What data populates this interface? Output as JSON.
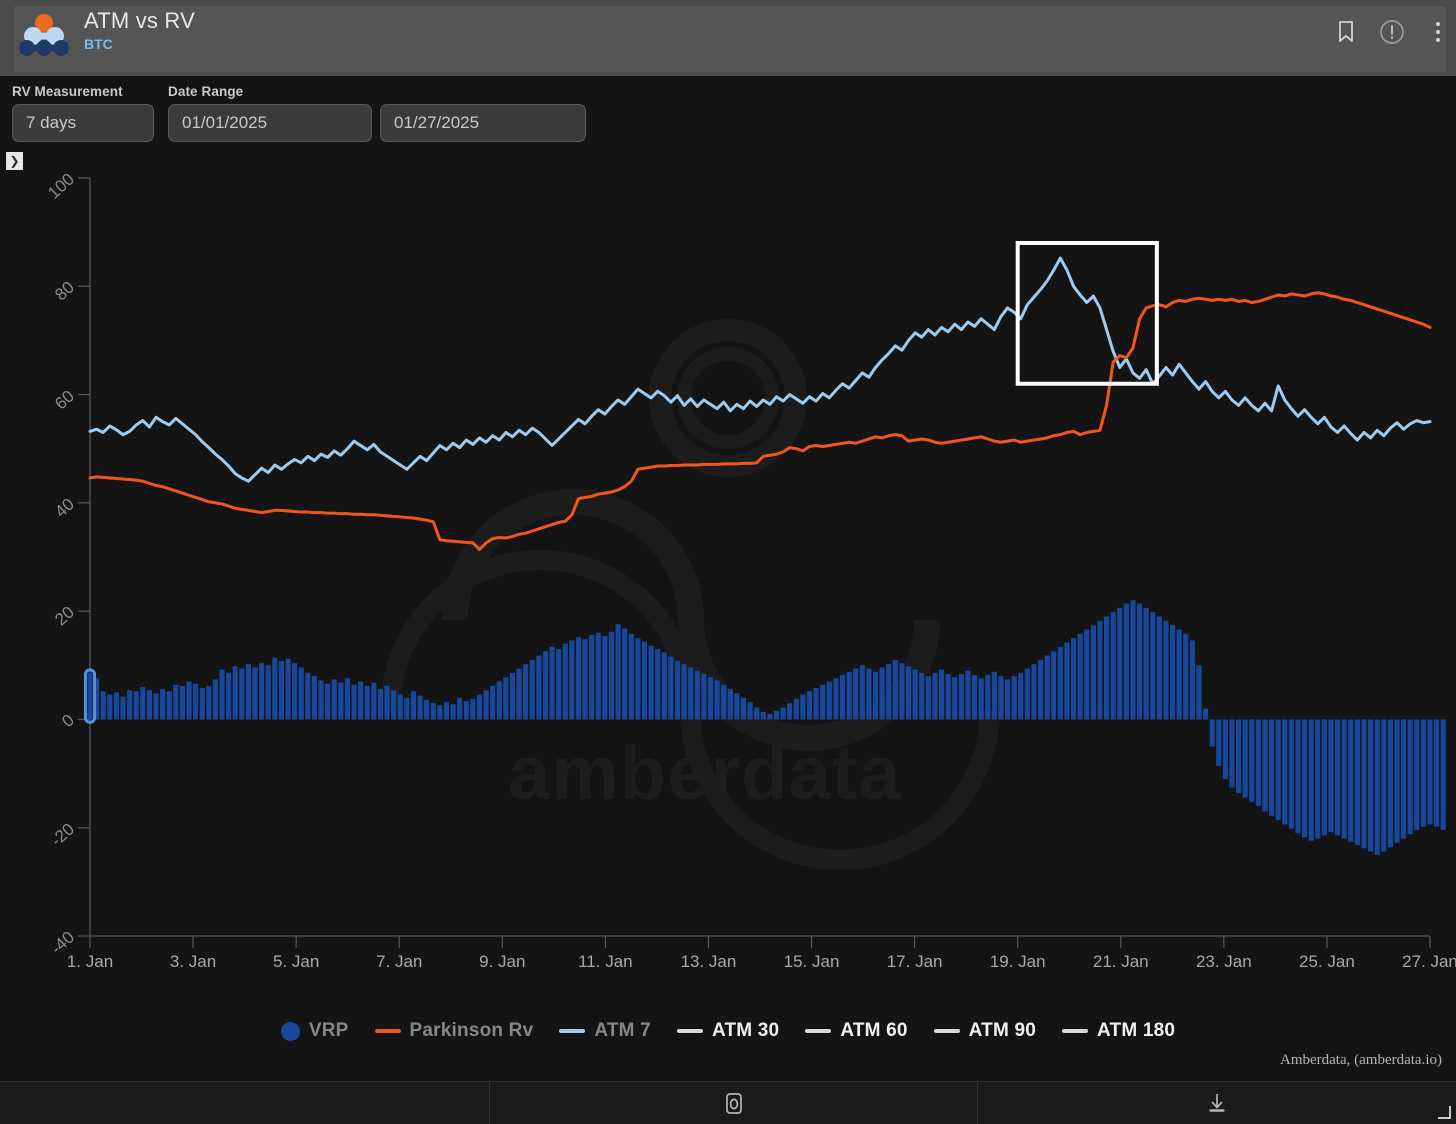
{
  "header": {
    "title": "ATM vs RV",
    "subtitle": "BTC",
    "actions": [
      {
        "name": "bookmark-icon",
        "label": "Bookmark"
      },
      {
        "name": "info-icon",
        "label": "Info"
      },
      {
        "name": "more-menu-icon",
        "label": "More options"
      }
    ],
    "logo_name": "amberdata-logo",
    "logo_colors": {
      "top": "#ee6b1f",
      "middle": "#bcd9ef",
      "bottom": "#1f3a66"
    }
  },
  "controls": {
    "rv_measurement": {
      "label": "RV Measurement",
      "value": "7 days"
    },
    "date_range": {
      "label": "Date Range",
      "start": "01/01/2025",
      "end": "01/27/2025"
    }
  },
  "expander": {
    "glyph": "❯"
  },
  "watermark": {
    "text": "amberdata"
  },
  "attribution": "Amberdata, (amberdata.io)",
  "bottom_bar": {
    "camera_label": "Screenshot",
    "download_label": "Download"
  },
  "chart_data": {
    "type": "line",
    "title": "ATM vs RV",
    "xlabel": "",
    "ylabel": "",
    "ylim": [
      -40,
      100
    ],
    "yticks": [
      100,
      80,
      60,
      40,
      20,
      0,
      -20,
      -40
    ],
    "xlim": [
      "2025-01-01",
      "2025-01-27"
    ],
    "xticks": [
      "1. Jan",
      "3. Jan",
      "5. Jan",
      "7. Jan",
      "9. Jan",
      "11. Jan",
      "13. Jan",
      "15. Jan",
      "17. Jan",
      "19. Jan",
      "21. Jan",
      "23. Jan",
      "25. Jan",
      "27. Jan"
    ],
    "grid": false,
    "legend_position": "bottom",
    "legend": [
      {
        "label": "VRP",
        "color": "#18489e",
        "marker": "dot",
        "visible": true
      },
      {
        "label": "Parkinson Rv",
        "color": "#f2561a",
        "marker": "line",
        "visible": true
      },
      {
        "label": "ATM 7",
        "color": "#9ecbf0",
        "marker": "line",
        "visible": true
      },
      {
        "label": "ATM 30",
        "color": "#d8d8d8",
        "marker": "line",
        "visible": false
      },
      {
        "label": "ATM 60",
        "color": "#d8d8d8",
        "marker": "line",
        "visible": false
      },
      {
        "label": "ATM 90",
        "color": "#d8d8d8",
        "marker": "line",
        "visible": false
      },
      {
        "label": "ATM 180",
        "color": "#d8d8d8",
        "marker": "line",
        "visible": false
      }
    ],
    "annotation": {
      "type": "rectangle",
      "color": "#ffffff",
      "x_start": "2025-01-19",
      "x_end": "2025-01-21.6",
      "y_top": 88,
      "y_bottom": 62
    },
    "highlighted_bar_index": 0,
    "series": [
      {
        "name": "ATM 7",
        "color": "#9ecbf0",
        "values": [
          53.2,
          53.6,
          53.0,
          54.2,
          53.5,
          52.6,
          53.2,
          54.4,
          55.2,
          54.0,
          55.8,
          55.0,
          54.4,
          55.6,
          54.6,
          53.6,
          52.6,
          51.3,
          50.2,
          49.0,
          48.0,
          46.8,
          45.4,
          44.6,
          44.0,
          45.2,
          46.4,
          45.6,
          47.0,
          46.2,
          47.2,
          48.0,
          47.4,
          48.6,
          47.8,
          49.0,
          48.4,
          49.6,
          48.8,
          50.0,
          51.4,
          50.6,
          49.8,
          50.8,
          49.4,
          48.6,
          47.8,
          47.0,
          46.2,
          47.4,
          48.6,
          47.8,
          49.2,
          50.6,
          49.8,
          51.0,
          50.2,
          51.6,
          50.8,
          52.0,
          51.2,
          52.4,
          51.6,
          53.0,
          52.2,
          53.4,
          52.6,
          53.8,
          53.0,
          51.8,
          50.6,
          51.8,
          53.0,
          54.2,
          55.4,
          54.6,
          56.0,
          57.2,
          56.4,
          57.8,
          59.0,
          58.2,
          59.6,
          61.0,
          60.2,
          59.4,
          60.6,
          59.8,
          58.6,
          59.8,
          58.0,
          59.2,
          57.8,
          59.0,
          58.2,
          57.4,
          58.6,
          57.0,
          58.2,
          57.4,
          58.8,
          57.8,
          59.0,
          58.2,
          59.6,
          58.8,
          60.0,
          59.2,
          58.4,
          59.6,
          58.8,
          60.2,
          59.4,
          60.8,
          62.0,
          61.2,
          62.6,
          64.0,
          63.2,
          65.0,
          66.4,
          67.6,
          69.0,
          68.2,
          70.0,
          71.4,
          70.6,
          72.0,
          71.0,
          72.4,
          71.6,
          73.0,
          72.0,
          73.4,
          72.6,
          74.0,
          73.0,
          72.0,
          74.4,
          76.0,
          75.2,
          74.0,
          76.6,
          78.0,
          79.4,
          81.0,
          83.0,
          85.2,
          83.0,
          80.0,
          78.4,
          77.0,
          78.2,
          76.0,
          72.0,
          68.0,
          65.0,
          66.6,
          64.0,
          63.0,
          64.6,
          62.0,
          63.4,
          65.0,
          63.6,
          65.6,
          64.0,
          62.4,
          61.0,
          62.4,
          60.6,
          59.4,
          60.6,
          59.0,
          58.0,
          59.4,
          58.0,
          57.0,
          58.4,
          57.0,
          61.6,
          59.0,
          57.4,
          56.0,
          57.2,
          55.8,
          54.6,
          55.8,
          54.0,
          53.0,
          54.2,
          52.8,
          51.6,
          53.0,
          52.0,
          53.4,
          52.4,
          53.8,
          54.8,
          53.6,
          54.6,
          55.2,
          54.8,
          55.0
        ]
      },
      {
        "name": "Parkinson Rv",
        "color": "#f2561a",
        "values": [
          44.6,
          44.8,
          44.7,
          44.6,
          44.5,
          44.4,
          44.3,
          44.2,
          44.0,
          43.6,
          43.2,
          43.0,
          42.6,
          42.2,
          41.8,
          41.4,
          41.0,
          40.6,
          40.2,
          40.0,
          39.8,
          39.4,
          39.0,
          38.8,
          38.6,
          38.4,
          38.2,
          38.4,
          38.6,
          38.6,
          38.5,
          38.4,
          38.3,
          38.3,
          38.2,
          38.2,
          38.1,
          38.1,
          38.0,
          38.0,
          37.9,
          37.9,
          37.8,
          37.8,
          37.7,
          37.6,
          37.5,
          37.4,
          37.3,
          37.2,
          37.0,
          36.8,
          36.5,
          33.2,
          33.0,
          32.9,
          32.8,
          32.7,
          32.6,
          31.4,
          32.6,
          33.4,
          33.6,
          33.5,
          33.8,
          34.2,
          34.4,
          34.8,
          35.2,
          35.6,
          36.0,
          36.4,
          36.6,
          37.8,
          40.8,
          41.0,
          41.2,
          41.6,
          41.8,
          42.0,
          42.4,
          43.0,
          44.0,
          46.2,
          46.4,
          46.6,
          46.8,
          46.8,
          46.9,
          46.9,
          47.0,
          47.0,
          47.0,
          47.1,
          47.1,
          47.1,
          47.2,
          47.2,
          47.2,
          47.3,
          47.3,
          47.4,
          48.6,
          48.8,
          49.0,
          49.4,
          50.2,
          50.0,
          49.6,
          50.4,
          50.6,
          50.4,
          50.6,
          50.8,
          51.0,
          51.2,
          51.0,
          51.4,
          51.8,
          52.2,
          52.0,
          52.4,
          52.6,
          52.4,
          51.4,
          51.6,
          51.8,
          51.6,
          51.2,
          51.0,
          51.2,
          51.4,
          51.6,
          51.8,
          52.0,
          52.2,
          51.8,
          51.4,
          51.2,
          51.4,
          51.6,
          51.2,
          51.4,
          51.6,
          51.8,
          52.0,
          52.4,
          52.6,
          53.0,
          53.2,
          52.6,
          53.0,
          53.2,
          53.4,
          58.0,
          66.0,
          67.2,
          66.8,
          68.6,
          74.0,
          76.0,
          76.4,
          76.6,
          76.2,
          77.0,
          77.4,
          77.2,
          77.6,
          77.8,
          77.6,
          77.4,
          77.6,
          77.4,
          77.6,
          77.2,
          77.4,
          77.0,
          77.2,
          77.6,
          78.0,
          78.4,
          78.2,
          78.6,
          78.4,
          78.2,
          78.6,
          78.8,
          78.6,
          78.2,
          78.0,
          77.6,
          77.4,
          77.0,
          76.6,
          76.2,
          75.8,
          75.4,
          75.0,
          74.6,
          74.2,
          73.8,
          73.4,
          73.0,
          72.4
        ]
      }
    ],
    "bars": {
      "name": "VRP",
      "color": "#18489e",
      "values": [
        8.6,
        7.6,
        5.2,
        4.6,
        5.0,
        4.2,
        5.4,
        5.2,
        6.0,
        5.4,
        4.8,
        5.6,
        5.2,
        6.4,
        6.2,
        7.0,
        6.6,
        5.8,
        6.2,
        7.4,
        9.2,
        8.6,
        9.8,
        9.4,
        10.2,
        9.6,
        10.4,
        10.0,
        11.4,
        10.8,
        11.2,
        10.4,
        9.6,
        8.6,
        8.0,
        7.2,
        6.6,
        7.4,
        6.8,
        7.6,
        6.4,
        7.0,
        6.2,
        6.8,
        5.6,
        6.2,
        5.4,
        4.6,
        4.0,
        5.2,
        4.4,
        3.6,
        3.0,
        2.6,
        3.2,
        2.8,
        4.0,
        3.4,
        3.8,
        4.6,
        5.4,
        6.2,
        7.0,
        7.8,
        8.6,
        9.4,
        10.2,
        11.0,
        11.8,
        12.6,
        13.4,
        13.0,
        14.0,
        14.6,
        15.2,
        14.8,
        15.6,
        16.0,
        15.4,
        16.2,
        17.6,
        16.8,
        15.8,
        15.0,
        14.4,
        13.6,
        13.0,
        12.4,
        11.6,
        10.8,
        10.2,
        9.6,
        9.0,
        8.4,
        7.8,
        7.2,
        6.4,
        5.6,
        4.8,
        4.0,
        3.2,
        2.2,
        1.4,
        1.0,
        1.6,
        2.2,
        3.0,
        3.8,
        4.6,
        5.2,
        5.8,
        6.4,
        7.0,
        7.6,
        8.2,
        8.8,
        9.4,
        10.0,
        9.4,
        8.8,
        9.6,
        10.2,
        11.0,
        10.4,
        9.8,
        9.2,
        8.6,
        8.0,
        8.6,
        9.2,
        8.4,
        7.8,
        8.4,
        9.0,
        8.2,
        7.6,
        8.2,
        8.8,
        8.0,
        7.4,
        8.0,
        8.6,
        9.4,
        10.2,
        11.0,
        11.8,
        12.6,
        13.4,
        14.2,
        15.0,
        15.8,
        16.6,
        17.4,
        18.2,
        19.0,
        19.8,
        20.6,
        21.4,
        22.0,
        21.4,
        20.6,
        19.8,
        19.0,
        18.2,
        17.4,
        16.6,
        15.8,
        14.6,
        10.0,
        2.0,
        -5.0,
        -8.6,
        -11.0,
        -12.6,
        -13.6,
        -14.4,
        -15.2,
        -16.0,
        -17.0,
        -17.8,
        -18.6,
        -19.4,
        -20.2,
        -21.0,
        -21.8,
        -22.4,
        -22.0,
        -21.4,
        -20.8,
        -21.4,
        -22.0,
        -22.6,
        -23.2,
        -23.8,
        -24.4,
        -25.0,
        -24.4,
        -23.6,
        -22.8,
        -22.0,
        -21.2,
        -20.4,
        -19.8,
        -19.4,
        -19.8,
        -20.4
      ]
    }
  }
}
